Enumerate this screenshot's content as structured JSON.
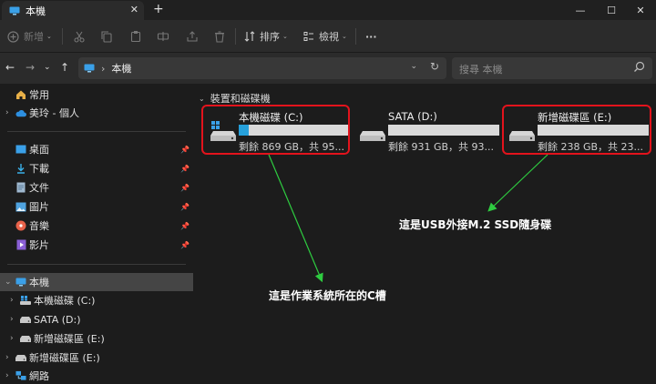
{
  "window": {
    "tab_title": "本機",
    "tab_close": "✕",
    "new_tab": "+",
    "min_glyph": "—",
    "max_glyph": "☐",
    "close_glyph": "✕"
  },
  "toolbar": {
    "new_label": "新增",
    "sort_label": "排序",
    "view_label": "檢視",
    "more_label": "···"
  },
  "address": {
    "separator": "›",
    "location": "本機",
    "search_placeholder": "搜尋 本機"
  },
  "sidebar": {
    "home": "常用",
    "personal": "美玲 - 個人",
    "quick": [
      {
        "label": "桌面"
      },
      {
        "label": "下載"
      },
      {
        "label": "文件"
      },
      {
        "label": "圖片"
      },
      {
        "label": "音樂"
      },
      {
        "label": "影片"
      }
    ],
    "this_pc": "本機",
    "drives": [
      {
        "label": "本機磁碟 (C:)"
      },
      {
        "label": "SATA (D:)"
      },
      {
        "label": "新增磁碟區 (E:)"
      }
    ],
    "removable": "新增磁碟區 (E:)",
    "network": "網路"
  },
  "content": {
    "group_title": "裝置和磁碟機",
    "drives": [
      {
        "name": "本機磁碟 (C:)",
        "free": "剩餘 869 GB，共 95...",
        "used_fraction": 0.09
      },
      {
        "name": "SATA (D:)",
        "free": "剩餘 931 GB，共 93...",
        "used_fraction": 0.0
      },
      {
        "name": "新增磁碟區 (E:)",
        "free": "剩餘 238 GB，共 23...",
        "used_fraction": 0.0
      }
    ]
  },
  "annotations": {
    "usb_note": "這是USB外接M.2 SSD隨身碟",
    "c_note": "這是作業系統所在的C槽",
    "box_color": "#e3131c",
    "arrow_color": "#2ecc40"
  },
  "colors": {
    "accent": "#26a0da",
    "bar_empty": "#d9d9d9"
  }
}
